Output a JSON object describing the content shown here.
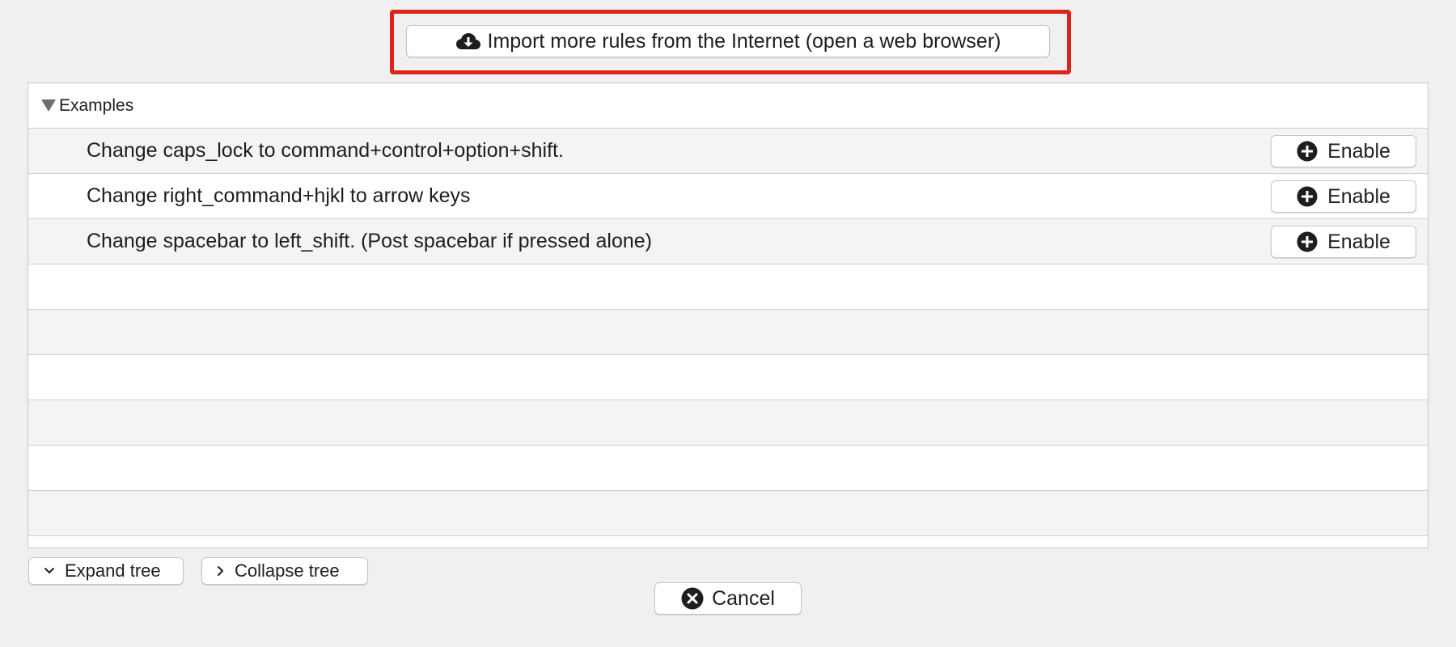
{
  "import_button": {
    "label": "Import more rules from the Internet (open a web browser)",
    "icon": "cloud-download-icon"
  },
  "highlight_color": "#dd2418",
  "tree": {
    "group_label": "Examples",
    "rules": [
      {
        "label": "Change caps_lock to command+control+option+shift.",
        "button": "Enable"
      },
      {
        "label": "Change right_command+hjkl to arrow keys",
        "button": "Enable"
      },
      {
        "label": "Change spacebar to left_shift. (Post spacebar if pressed alone)",
        "button": "Enable"
      }
    ]
  },
  "footer": {
    "expand_label": "Expand tree",
    "collapse_label": "Collapse tree",
    "cancel_label": "Cancel"
  }
}
